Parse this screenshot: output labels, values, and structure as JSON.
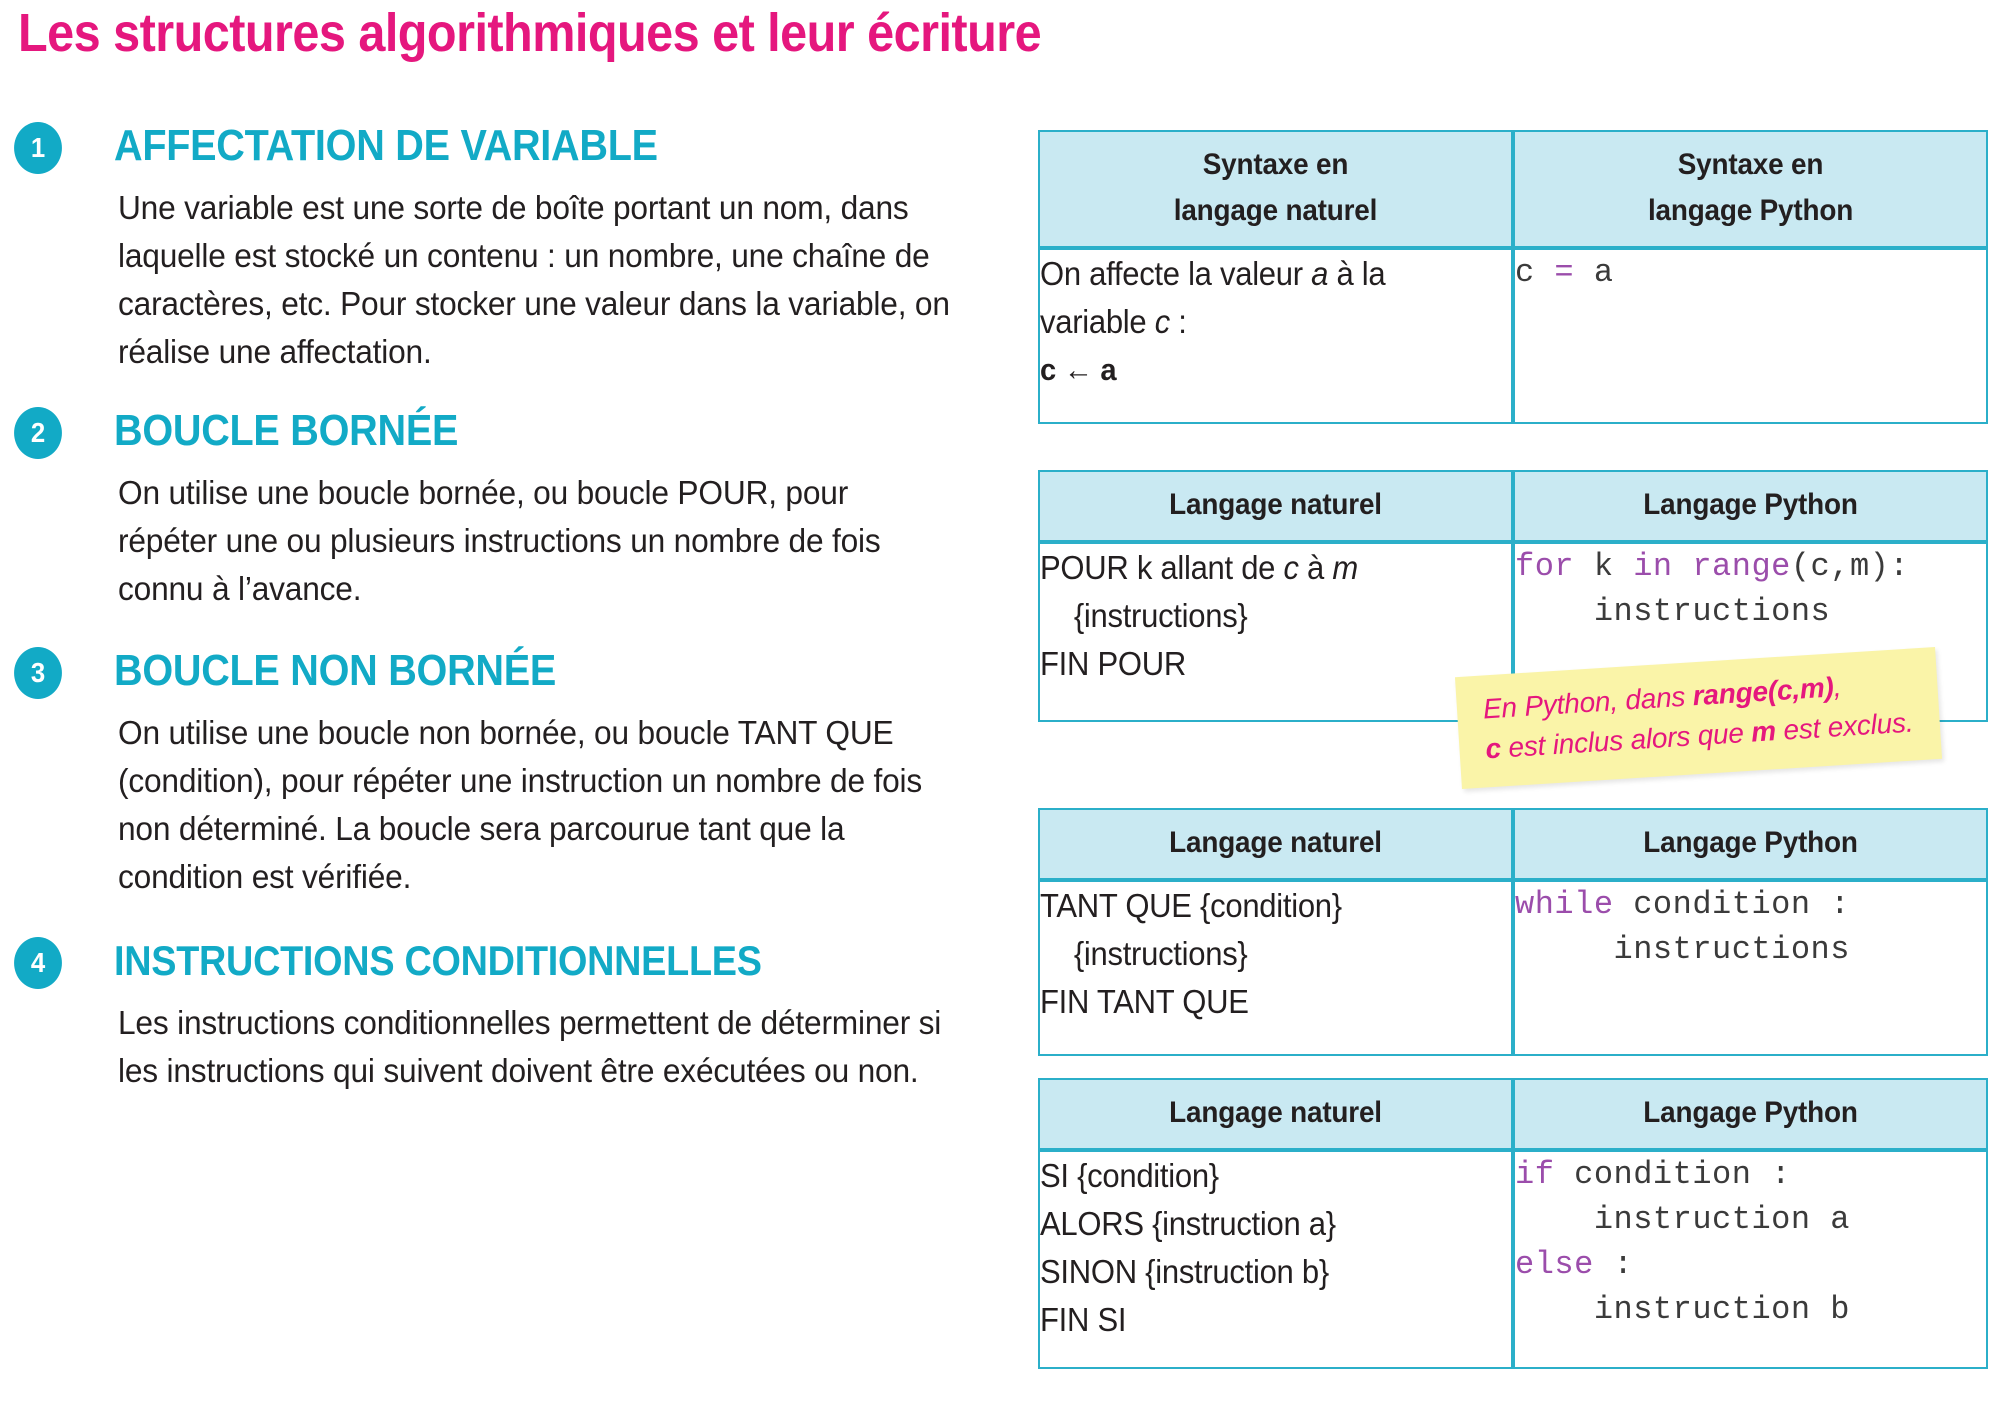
{
  "colors": {
    "title_magenta": "#E5177E",
    "accent_cyan": "#12AAC6",
    "table_border_cyan": "#2BAFC9",
    "table_header_fill": "#C9E9F2",
    "python_keyword_purple": "#9B4DAB",
    "note_yellow": "#FAF4A8",
    "body_text": "#231f20"
  },
  "page": {
    "title": "Les structures algorithmiques et leur écriture"
  },
  "sections": [
    {
      "number": "1",
      "title": "AFFECTATION DE VARIABLE",
      "body": "Une variable est une sorte de boîte portant un nom, dans laquelle est stocké un contenu : un nombre, une chaîne de caractères, etc. Pour stocker une valeur dans la variable, on réalise une affectation."
    },
    {
      "number": "2",
      "title": "BOUCLE BORNÉE",
      "body": "On utilise une boucle bornée, ou boucle POUR, pour répéter une ou plusieurs instructions un nombre de fois connu à l’avance."
    },
    {
      "number": "3",
      "title": "BOUCLE NON BORNÉE",
      "body": "On utilise une boucle non bornée, ou boucle TANT QUE (condition), pour répéter une instruction un nombre de fois non déterminé. La boucle sera parcourue tant que la condition est vérifiée."
    },
    {
      "number": "4",
      "title": "INSTRUCTIONS CONDITIONNELLES",
      "body": "Les instructions conditionnelles permettent de déterminer si les instructions qui suivent doivent être exécutées ou non."
    }
  ],
  "tables": [
    {
      "id": "affectation",
      "headers": {
        "natural_line1": "Syntaxe en",
        "natural_line2": "langage naturel",
        "python_line1": "Syntaxe en",
        "python_line2": "langage Python"
      },
      "natural_lines": {
        "l1_pre": "On affecte la valeur ",
        "l1_var": "a",
        "l1_post": " à la",
        "l2_pre": "variable ",
        "l2_var": "c",
        "l2_post": " :",
        "l3": "c ← a"
      },
      "python_code": {
        "line1_var": "c",
        "line1_op": "=",
        "line1_val": "a"
      }
    },
    {
      "id": "boucle-bornee",
      "headers": {
        "natural": "Langage naturel",
        "python": "Langage Python"
      },
      "natural_lines": {
        "l1_pre": "POUR k allant de ",
        "l1_var1": "c",
        "l1_mid": " à ",
        "l1_var2": "m",
        "l2": "{instructions}",
        "l3": "FIN POUR"
      },
      "python_code": {
        "kw1": "for",
        "mid1": " k ",
        "kw2": "in",
        "mid2": " ",
        "kw3": "range",
        "tail": "(c,m):",
        "line2": "    instructions"
      }
    },
    {
      "id": "boucle-non-bornee",
      "headers": {
        "natural": "Langage naturel",
        "python": "Langage Python"
      },
      "natural_lines": {
        "l1": "TANT QUE {condition}",
        "l2": "{instructions}",
        "l3": "FIN TANT QUE"
      },
      "python_code": {
        "kw1": "while",
        "tail1": " condition :",
        "line2": "     instructions"
      }
    },
    {
      "id": "conditionnelles",
      "headers": {
        "natural": "Langage naturel",
        "python": "Langage Python"
      },
      "natural_lines": {
        "l1": "SI {condition}",
        "l2": "ALORS {instruction a}",
        "l3": "SINON {instruction b}",
        "l4": "FIN SI"
      },
      "python_code": {
        "kw1": "if",
        "tail1": " condition :",
        "line2": "    instruction a",
        "kw2": "else",
        "tail2": " :",
        "line4": "    instruction b"
      }
    }
  ],
  "note": {
    "l1_pre": "En Python, dans ",
    "l1_bold": "range(c,m)",
    "l1_post": ",",
    "l2_bold1": "c",
    "l2_mid": " est inclus alors que ",
    "l2_bold2": "m",
    "l2_post": " est exclus."
  }
}
